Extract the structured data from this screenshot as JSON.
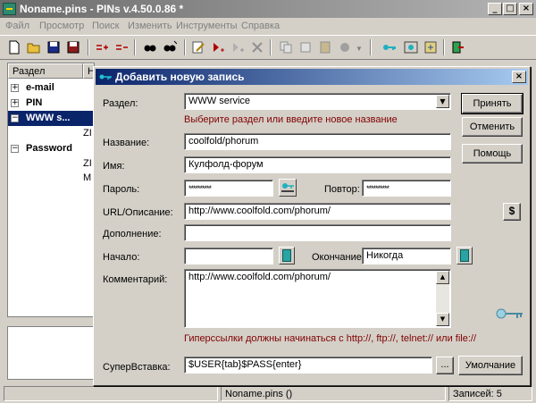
{
  "window": {
    "title": "Noname.pins - PINs v.4.50.0.86 *",
    "min": "_",
    "max": "□",
    "close": "×"
  },
  "menu": [
    "Файл",
    "Просмотр",
    "Поиск",
    "Изменить",
    "Инструменты",
    "Справка"
  ],
  "tree": {
    "col_section": "Раздел",
    "col_name": "Н",
    "items": [
      {
        "label": "e-mail",
        "expander": "+"
      },
      {
        "label": "PIN",
        "expander": "+"
      },
      {
        "label": "WWW s...",
        "expander": "−"
      },
      {
        "label": "Password",
        "expander": "−"
      }
    ],
    "sub_items": [
      "ZI",
      "ZI",
      "M"
    ]
  },
  "status": {
    "file": "Noname.pins ()",
    "records": "Записей: 5"
  },
  "dialog": {
    "title": "Добавить новую запись",
    "close": "×",
    "section_label": "Раздел:",
    "section_value": "WWW service",
    "section_hint": "Выберите раздел или введите новое название",
    "name_label": "Название:",
    "name_value": "coolfold/phorum",
    "login_label": "Имя:",
    "login_value": "Кулфолд-форум",
    "password_label": "Пароль:",
    "password_value": "**********",
    "repeat_label": "Повтор:",
    "repeat_value": "**********",
    "url_label": "URL/Описание:",
    "url_value": "http://www.coolfold.com/phorum/",
    "extra_label": "Дополнение:",
    "extra_value": "",
    "start_label": "Начало:",
    "start_value": "",
    "end_label": "Окончание:",
    "end_value": "Никогда",
    "comment_label": "Комментарий:",
    "comment_value": "http://www.coolfold.com/phorum/",
    "link_hint": "Гиперссылки должны начинаться с http://, ftp://, telnet:// или file://",
    "superpaste_label": "СуперВставка:",
    "superpaste_value": "$USER{tab}$PASS{enter}",
    "browse": "...",
    "accept": "Принять",
    "cancel": "Отменить",
    "help": "Помощь",
    "default": "Умолчание",
    "dollar": "$"
  }
}
